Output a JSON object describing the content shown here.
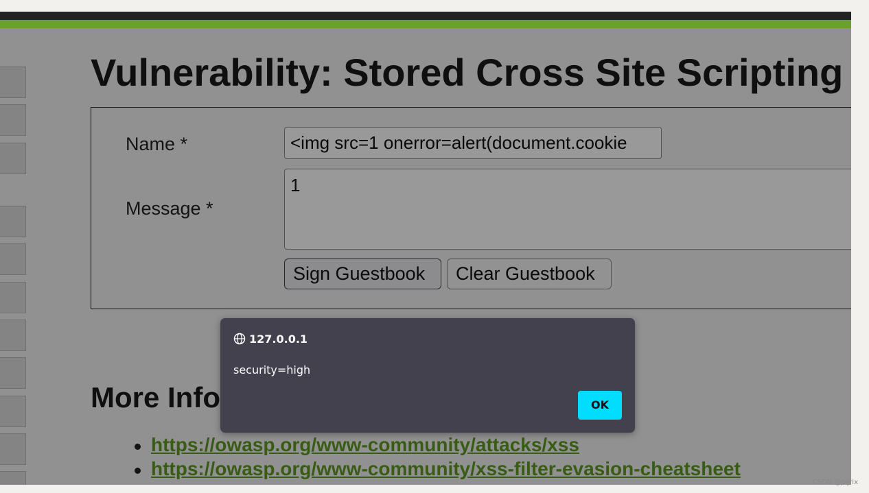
{
  "page": {
    "title": "Vulnerability: Stored Cross Site Scripting",
    "form": {
      "name_label": "Name *",
      "name_value": "<img src=1 onerror=alert(document.cookie",
      "message_label": "Message *",
      "message_value": "1",
      "sign_button": "Sign Guestbook",
      "clear_button": "Clear Guestbook"
    },
    "more_info_heading": "More Info",
    "links": [
      "https://owasp.org/www-community/attacks/xss",
      "https://owasp.org/www-community/xss-filter-evasion-cheatsheet"
    ]
  },
  "dialog": {
    "origin": "127.0.0.1",
    "origin_icon": "globe-icon",
    "message": "security=high",
    "ok_label": "OK"
  },
  "watermark": "CSDN @pijrix",
  "colors": {
    "accent_green": "#6aa12d",
    "link_green": "#5f9a24",
    "dialog_bg": "#42414d",
    "ok_button": "#00ddff"
  }
}
